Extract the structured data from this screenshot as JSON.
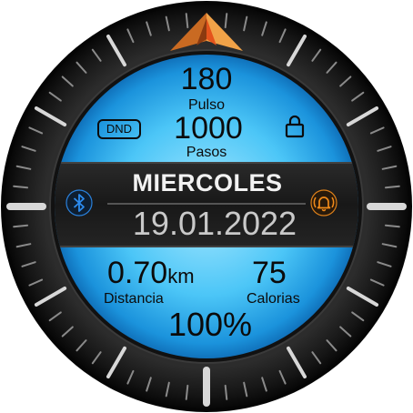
{
  "watchface": {
    "pulse": {
      "value": "180",
      "label": "Pulso"
    },
    "steps": {
      "value": "1000",
      "label": "Pasos"
    },
    "dnd_label": "DND",
    "day_name": "MIERCOLES",
    "date": "19.01.2022",
    "distance": {
      "value": "0.70",
      "unit": "km",
      "label": "Distancia"
    },
    "calories": {
      "value": "75",
      "label": "Calorias"
    },
    "battery": "100%",
    "icons": {
      "bluetooth": "bluetooth-icon",
      "alarm": "alarm-bell-icon",
      "lock": "lock-icon",
      "pointer": "compass-pointer-icon"
    },
    "colors": {
      "bezel": "#1b1b1b",
      "screen_light": "#9de4ff",
      "screen_mid": "#29b7f4",
      "screen_dark": "#0c68b4",
      "band": "#202020",
      "bluetooth": "#2c8cf0",
      "alarm": "#f08a1a",
      "pointer": "#e08a2c"
    }
  }
}
